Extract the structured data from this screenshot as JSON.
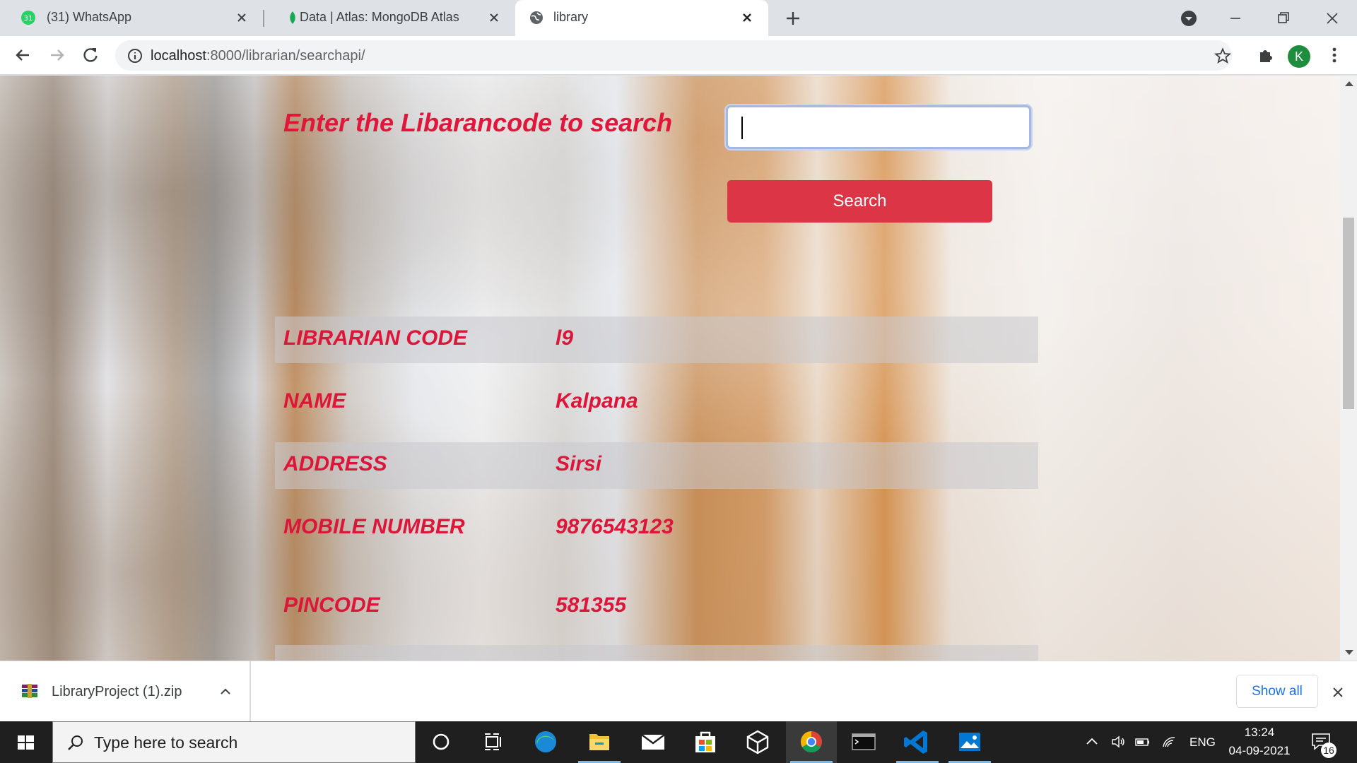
{
  "browser": {
    "tabs": [
      {
        "title": "(31) WhatsApp",
        "badge": "31",
        "icon": "whatsapp-icon"
      },
      {
        "title": "Data | Atlas: MongoDB Atlas",
        "icon": "mongodb-leaf-icon"
      },
      {
        "title": "library",
        "icon": "globe-icon",
        "active": true
      }
    ],
    "address": {
      "host": "localhost",
      "path": ":8000/librarian/searchapi/"
    },
    "profile_initial": "K"
  },
  "page": {
    "search_prompt": "Enter the Libarancode to search",
    "search_value": "",
    "search_button": "Search",
    "records": [
      {
        "label": "LIBRARIAN CODE",
        "value": "l9"
      },
      {
        "label": "NAME",
        "value": "Kalpana"
      },
      {
        "label": "ADDRESS",
        "value": "Sirsi"
      },
      {
        "label": "MOBILE NUMBER",
        "value": "9876543123"
      },
      {
        "label": "PINCODE",
        "value": "581355"
      }
    ],
    "accent_color": "#dc3545",
    "text_color": "#dc1639"
  },
  "downloads": {
    "file": "LibraryProject (1).zip",
    "show_all": "Show all"
  },
  "taskbar": {
    "search_placeholder": "Type here to search",
    "language": "ENG",
    "time": "13:24",
    "date": "04-09-2021",
    "notifications": "16"
  }
}
